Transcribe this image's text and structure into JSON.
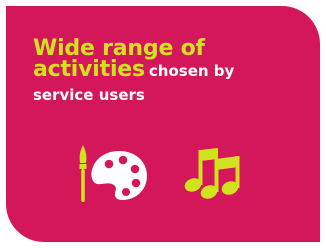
{
  "card": {
    "headline_line1": "Wide range of",
    "headline_line2_big": "activities",
    "headline_line2_small": "chosen by",
    "headline_line3": "service users"
  },
  "icons": [
    {
      "name": "paintbrush-icon",
      "color": "#cfe21d"
    },
    {
      "name": "palette-icon",
      "color": "#ffffff"
    },
    {
      "name": "music-notes-icon",
      "color": "#cfe21d"
    }
  ],
  "colors": {
    "background": "#d4175a",
    "accent": "#cfe21d",
    "text": "#ffffff"
  }
}
